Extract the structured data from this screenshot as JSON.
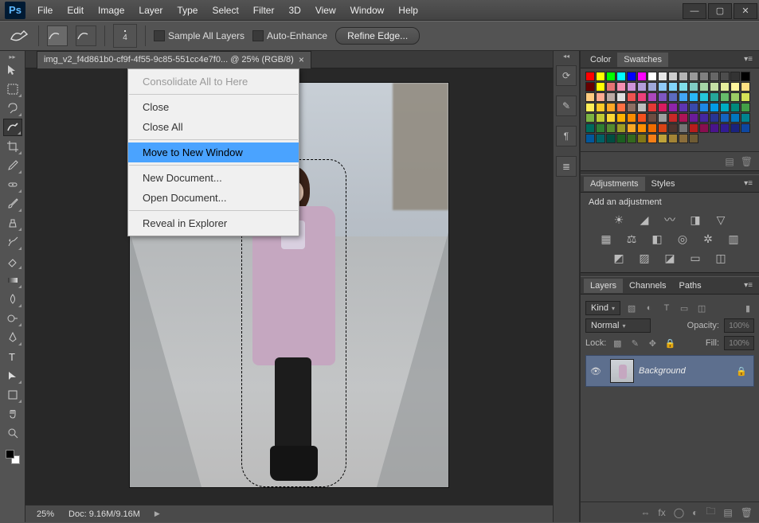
{
  "app": {
    "logo": "Ps"
  },
  "menu": [
    "File",
    "Edit",
    "Image",
    "Layer",
    "Type",
    "Select",
    "Filter",
    "3D",
    "View",
    "Window",
    "Help"
  ],
  "options": {
    "brush_size": "4",
    "sample_all": "Sample All Layers",
    "auto_enhance": "Auto-Enhance",
    "refine": "Refine Edge..."
  },
  "doc": {
    "tab": "img_v2_f4d861b0-cf9f-4f55-9c85-551cc4e7f0... @ 25% (RGB/8)",
    "zoom": "25%",
    "docsize_label": "Doc:",
    "docsize": "9.16M/9.16M"
  },
  "ctx": {
    "consolidate": "Consolidate All to Here",
    "close": "Close",
    "close_all": "Close All",
    "move_new": "Move to New Window",
    "new_doc": "New Document...",
    "open_doc": "Open Document...",
    "reveal": "Reveal in Explorer"
  },
  "panels": {
    "color": "Color",
    "swatches": "Swatches",
    "adjustments": "Adjustments",
    "styles": "Styles",
    "add_adj": "Add an adjustment",
    "layers": "Layers",
    "channels": "Channels",
    "paths": "Paths"
  },
  "layers": {
    "kind": "Kind",
    "blend": "Normal",
    "opacity_lbl": "Opacity:",
    "opacity_val": "100%",
    "lock_lbl": "Lock:",
    "fill_lbl": "Fill:",
    "fill_val": "100%",
    "layer_name": "Background"
  },
  "swatch_colors": [
    "#ff0000",
    "#ffff00",
    "#00ff00",
    "#00ffff",
    "#0000ff",
    "#ff00ff",
    "#ffffff",
    "#e6e6e6",
    "#cccccc",
    "#b3b3b3",
    "#999999",
    "#808080",
    "#666666",
    "#4d4d4d",
    "#333333",
    "#000000",
    "#660000",
    "#ffff00",
    "#e57373",
    "#f48fb1",
    "#ce93d8",
    "#b39ddb",
    "#9fa8da",
    "#90caf9",
    "#81d4fa",
    "#80deea",
    "#80cbc4",
    "#a5d6a7",
    "#c5e1a5",
    "#e6ee9c",
    "#fff59d",
    "#ffe082",
    "#ffcc80",
    "#ffab91",
    "#bcaaa4",
    "#e0e0e0",
    "#ef5350",
    "#ec407a",
    "#ab47bc",
    "#7e57c2",
    "#5c6bc0",
    "#42a5f5",
    "#29b6f6",
    "#26c6da",
    "#26a69a",
    "#66bb6a",
    "#9ccc65",
    "#d4e157",
    "#ffee58",
    "#ffca28",
    "#ffa726",
    "#ff7043",
    "#8d6e63",
    "#bdbdbd",
    "#e53935",
    "#d81b60",
    "#8e24aa",
    "#5e35b1",
    "#3949ab",
    "#1e88e5",
    "#039be5",
    "#00acc1",
    "#00897b",
    "#43a047",
    "#7cb342",
    "#c0ca33",
    "#fdd835",
    "#ffb300",
    "#fb8c00",
    "#f4511e",
    "#6d4c41",
    "#9e9e9e",
    "#c62828",
    "#ad1457",
    "#6a1b9a",
    "#4527a0",
    "#283593",
    "#1565c0",
    "#0277bd",
    "#00838f",
    "#00695c",
    "#2e7d32",
    "#558b2f",
    "#9e9d24",
    "#f9a825",
    "#ff8f00",
    "#ef6c00",
    "#d84315",
    "#4e342e",
    "#757575",
    "#b71c1c",
    "#880e4f",
    "#4a148c",
    "#311b92",
    "#1a237e",
    "#0d47a1",
    "#01579b",
    "#006064",
    "#004d40",
    "#1b5e20",
    "#33691e",
    "#827717",
    "#f57f17",
    "#bfa33a",
    "#a38436",
    "#8a6d3b",
    "#6e5b34"
  ]
}
